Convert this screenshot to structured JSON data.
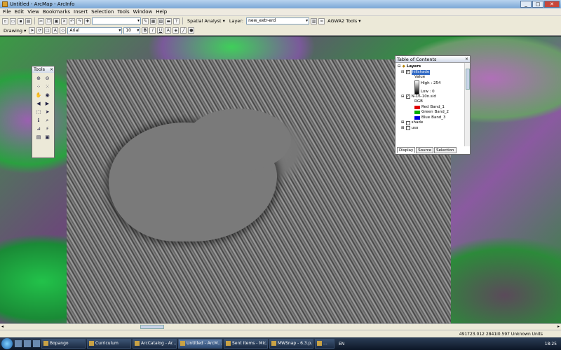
{
  "window": {
    "title": "Untitled - ArcMap - ArcInfo",
    "buttons": [
      "_",
      "□",
      "✕"
    ]
  },
  "menu": [
    "File",
    "Edit",
    "View",
    "Bookmarks",
    "Insert",
    "Selection",
    "Tools",
    "Window",
    "Help"
  ],
  "toolbar1": {
    "scale_value": "",
    "spatial_analyst_label": "Spatial Analyst ▾",
    "layer_label": "Layer:",
    "layer_value": "new_extr-erd",
    "agwa_label": "AGWA2 Tools ▾"
  },
  "toolbar2": {
    "drawing_label": "Drawing ▾",
    "font_name": "Arial",
    "font_size": "10",
    "bold": "B",
    "italic": "I",
    "underline": "U",
    "text_tool": "A"
  },
  "tools_window": {
    "title": "Tools",
    "close": "×"
  },
  "toc": {
    "title": "Table of Contents",
    "close": "×",
    "root": "Layers",
    "layer1": {
      "name": "hillshade",
      "legend_label": "Value",
      "high": "High : 254",
      "low": "Low : 0"
    },
    "layer2": {
      "name": "N-16-10n.sid",
      "legend_label": "RGB",
      "bands": [
        {
          "color": "Red",
          "band": "Band_1",
          "hex": "#e00000"
        },
        {
          "color": "Green",
          "band": "Band_2",
          "hex": "#00b000"
        },
        {
          "color": "Blue",
          "band": "Band_3",
          "hex": "#0000e0"
        }
      ]
    },
    "layer3": {
      "name": "shade"
    },
    "layer4": {
      "name": "uso"
    },
    "tabs": [
      "Display",
      "Source",
      "Selection"
    ]
  },
  "status": {
    "coords": "491723.012  2841i0.597 Unknown Units"
  },
  "taskbar": {
    "tasks": [
      "Bopango",
      "Curriculum",
      "ArcCatalog - Ar...",
      "Untitled - ArcM...",
      "Sent Items - Mic...",
      "MWSnap - 6.3.p...",
      "..."
    ],
    "lang": "EN",
    "time": "18:25"
  }
}
